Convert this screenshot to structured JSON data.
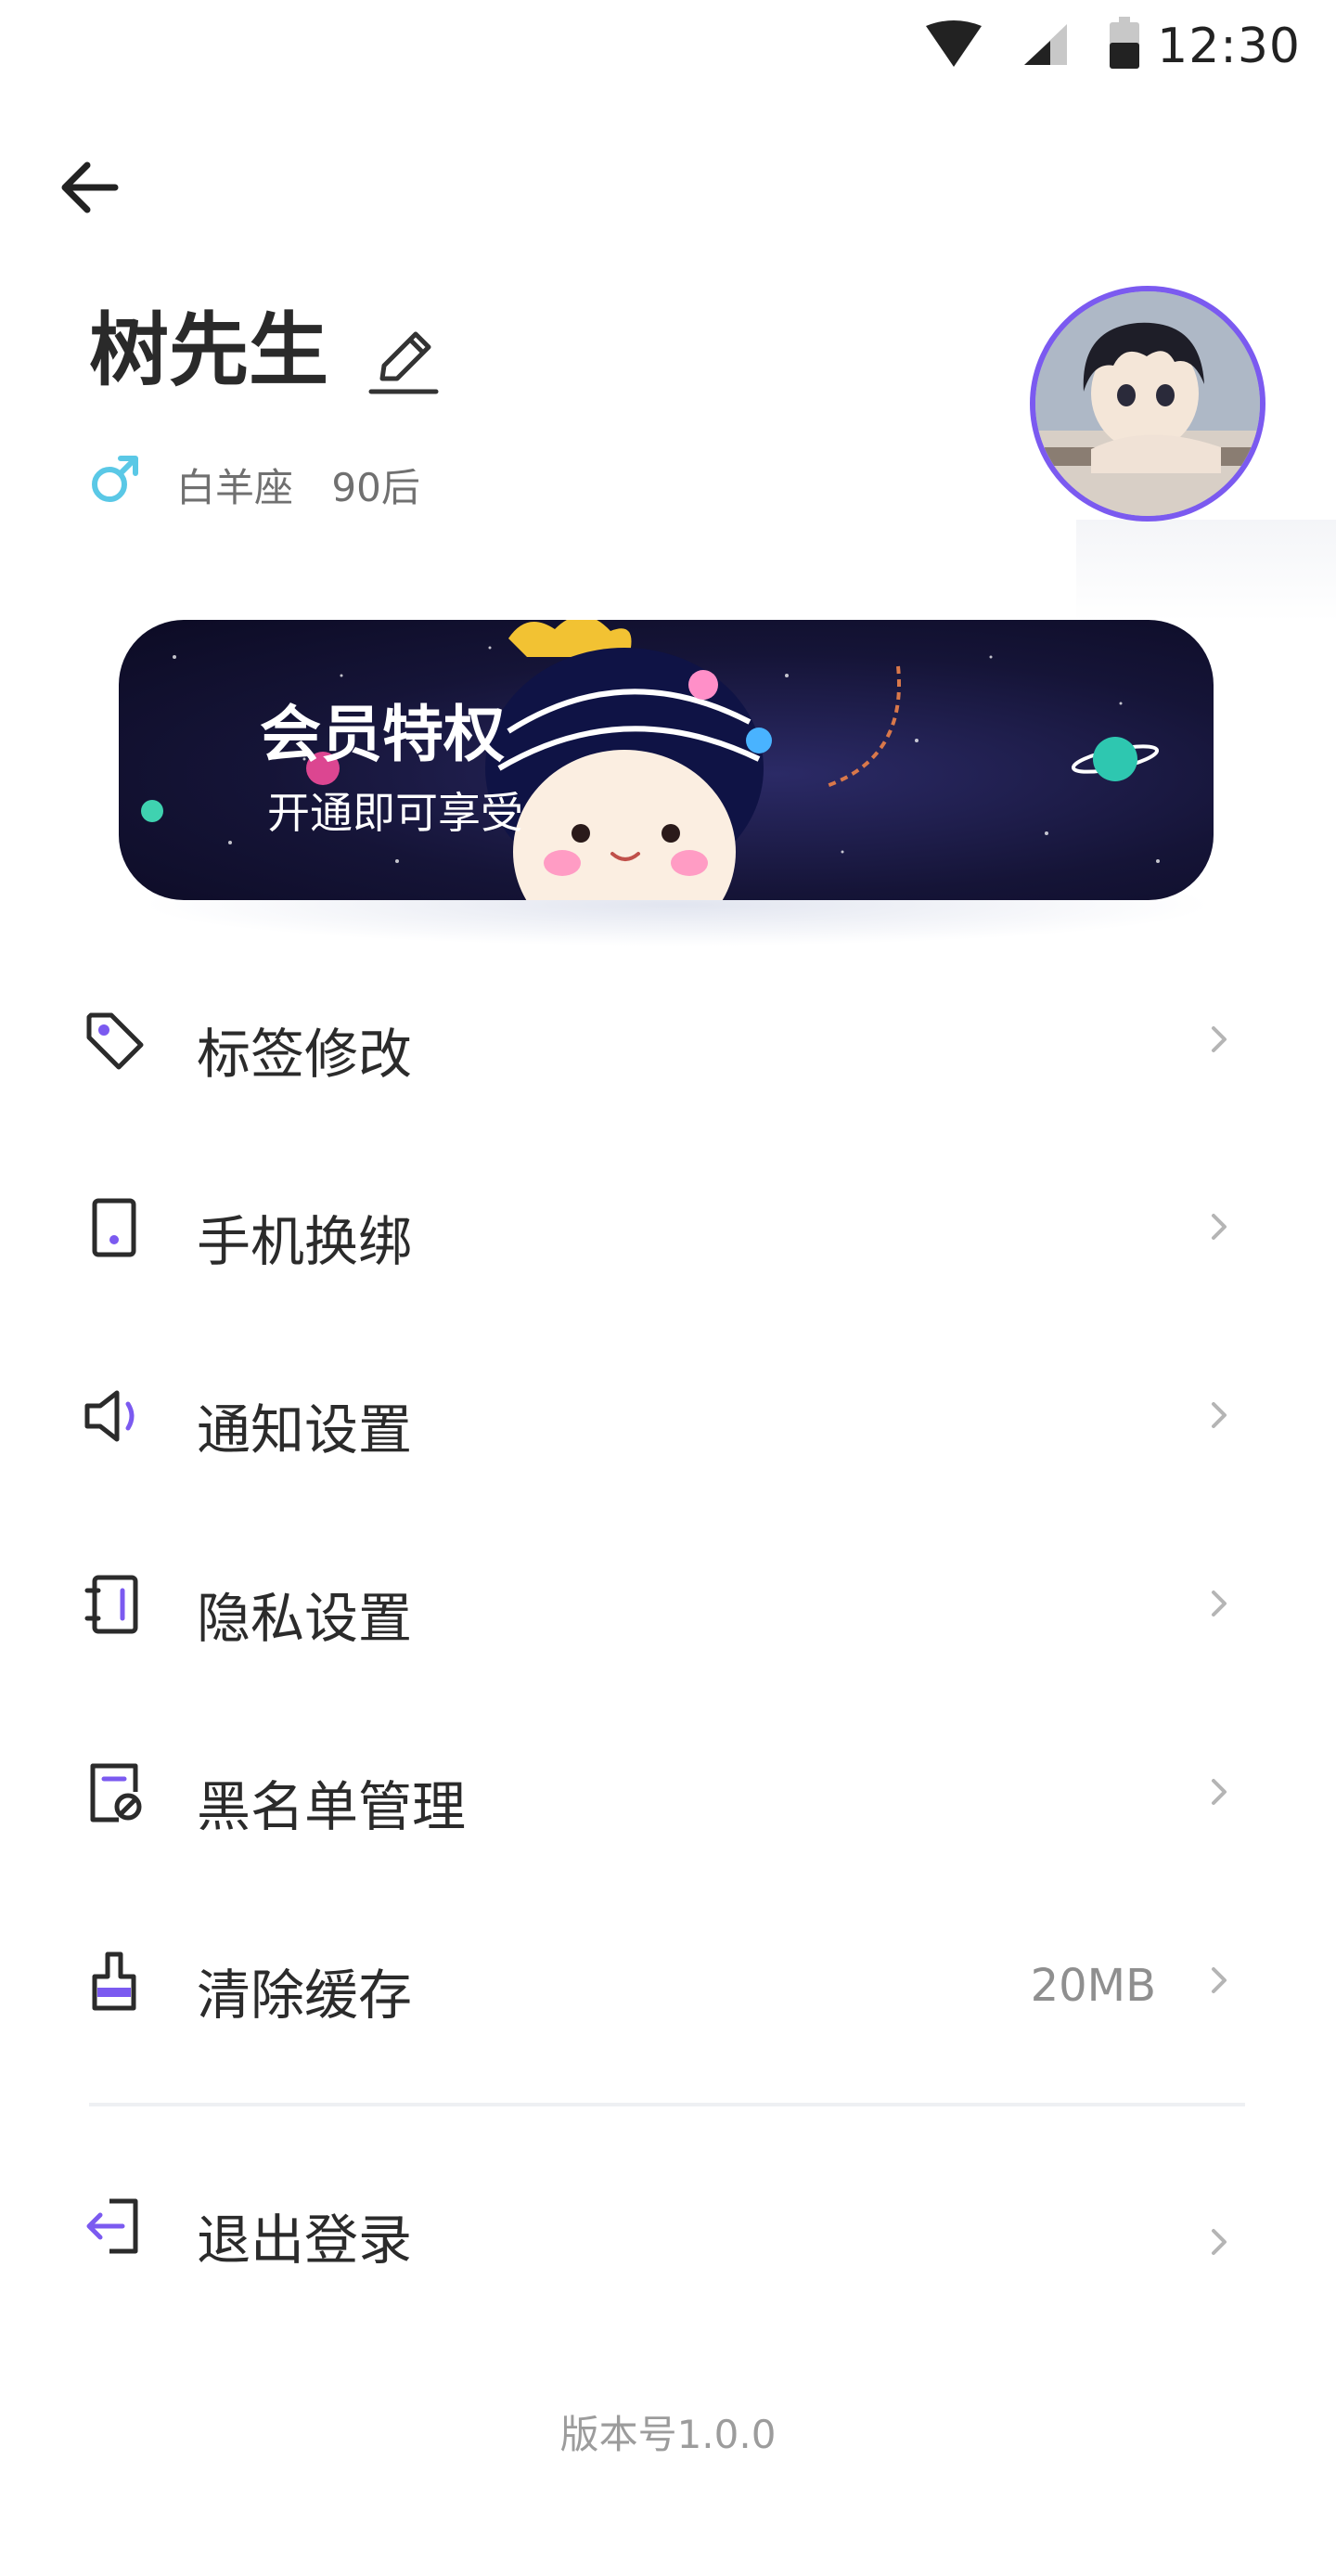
{
  "status_bar": {
    "time": "12:30"
  },
  "profile": {
    "name": "树先生",
    "constellation": "白羊座",
    "age_group": "90后"
  },
  "banner": {
    "title": "会员特权",
    "subtitle": "开通即可享受"
  },
  "menu": {
    "items": [
      {
        "label": "标签修改",
        "icon": "tag-icon"
      },
      {
        "label": "手机换绑",
        "icon": "phone-icon"
      },
      {
        "label": "通知设置",
        "icon": "speaker-icon"
      },
      {
        "label": "隐私设置",
        "icon": "privacy-book-icon"
      },
      {
        "label": "黑名单管理",
        "icon": "blacklist-icon"
      },
      {
        "label": "清除缓存",
        "icon": "brush-icon",
        "value": "20MB"
      }
    ],
    "logout": {
      "label": "退出登录",
      "icon": "logout-icon"
    }
  },
  "footer": {
    "version": "版本号1.0.0"
  },
  "colors": {
    "accent": "#7b5af0",
    "gender": "#5ac8e6",
    "text_primary": "#2b2b2b",
    "text_secondary": "#8f8f8f"
  }
}
